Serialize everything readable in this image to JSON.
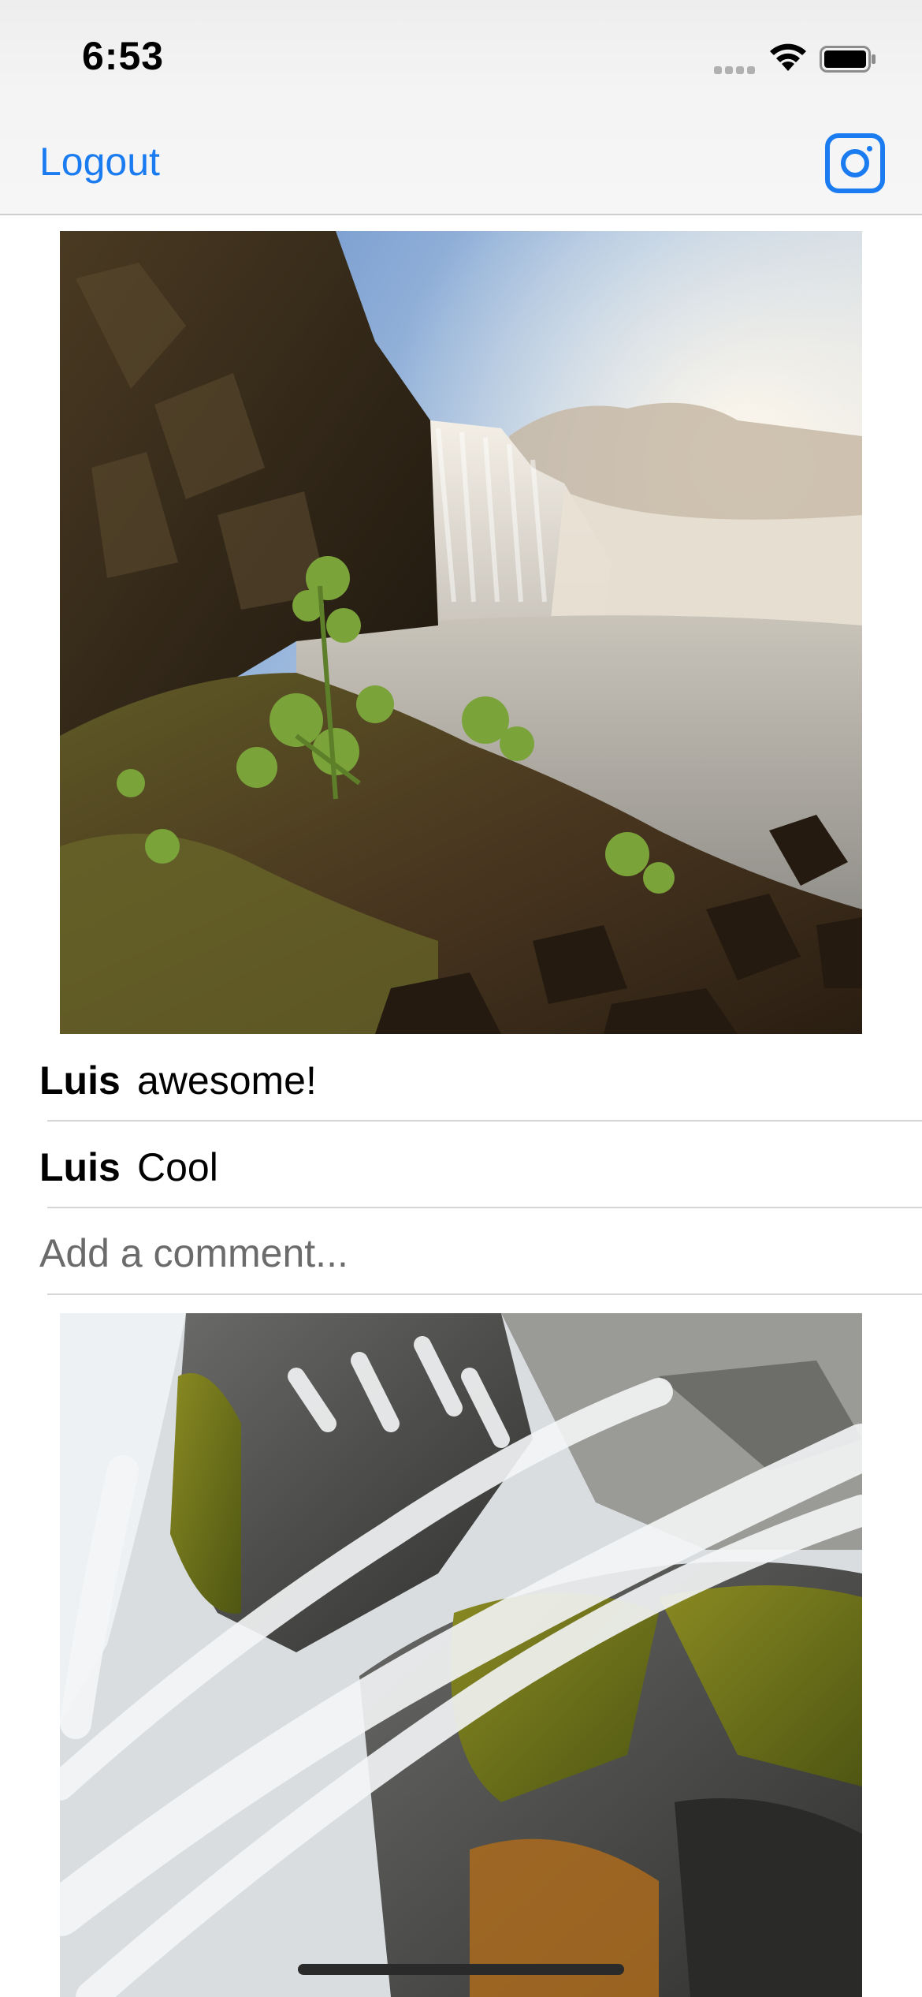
{
  "status_bar": {
    "time": "6:53",
    "icons": [
      "signal-icon",
      "wifi-icon",
      "battery-icon"
    ]
  },
  "nav_bar": {
    "logout_label": "Logout",
    "right_icon": "camera-icon",
    "accent_color": "#1a7cf0"
  },
  "feed": {
    "posts": [
      {
        "image": "waterfall-landscape-photo",
        "comments": [
          {
            "author": "Luis",
            "text": "awesome!"
          },
          {
            "author": "Luis",
            "text": "Cool"
          }
        ],
        "comment_placeholder": "Add a comment..."
      },
      {
        "image": "cascading-stream-photo"
      }
    ]
  }
}
